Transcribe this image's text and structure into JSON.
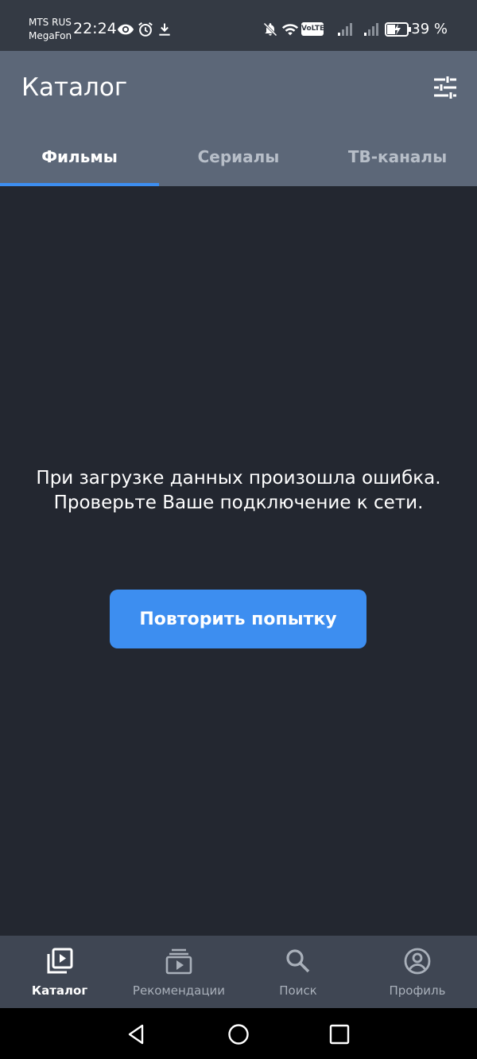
{
  "status_bar": {
    "carrier_1": "MTS RUS",
    "carrier_2": "MegaFon",
    "time": "22:24",
    "volte": "VoLTE",
    "battery": "39 %"
  },
  "app_bar": {
    "title": "Каталог",
    "filter_icon": "tune-icon"
  },
  "tabs": [
    {
      "label": "Фильмы",
      "active": true
    },
    {
      "label": "Сериалы",
      "active": false
    },
    {
      "label": "ТВ-каналы",
      "active": false
    }
  ],
  "error": {
    "line_1": "При загрузке данных произошла ошибка.",
    "line_2": "Проверьте Ваше подключение к сети.",
    "retry_label": "Повторить попытку"
  },
  "bottom_nav": [
    {
      "label": "Каталог",
      "icon": "video-library-icon",
      "active": true
    },
    {
      "label": "Рекомендации",
      "icon": "subscriptions-icon",
      "active": false
    },
    {
      "label": "Поиск",
      "icon": "search-icon",
      "active": false
    },
    {
      "label": "Профиль",
      "icon": "account-circle-icon",
      "active": false
    }
  ],
  "colors": {
    "accent": "#3d8ef0",
    "app_bar": "#5c6778",
    "background": "#232730",
    "bottom_nav": "#3f4653"
  }
}
